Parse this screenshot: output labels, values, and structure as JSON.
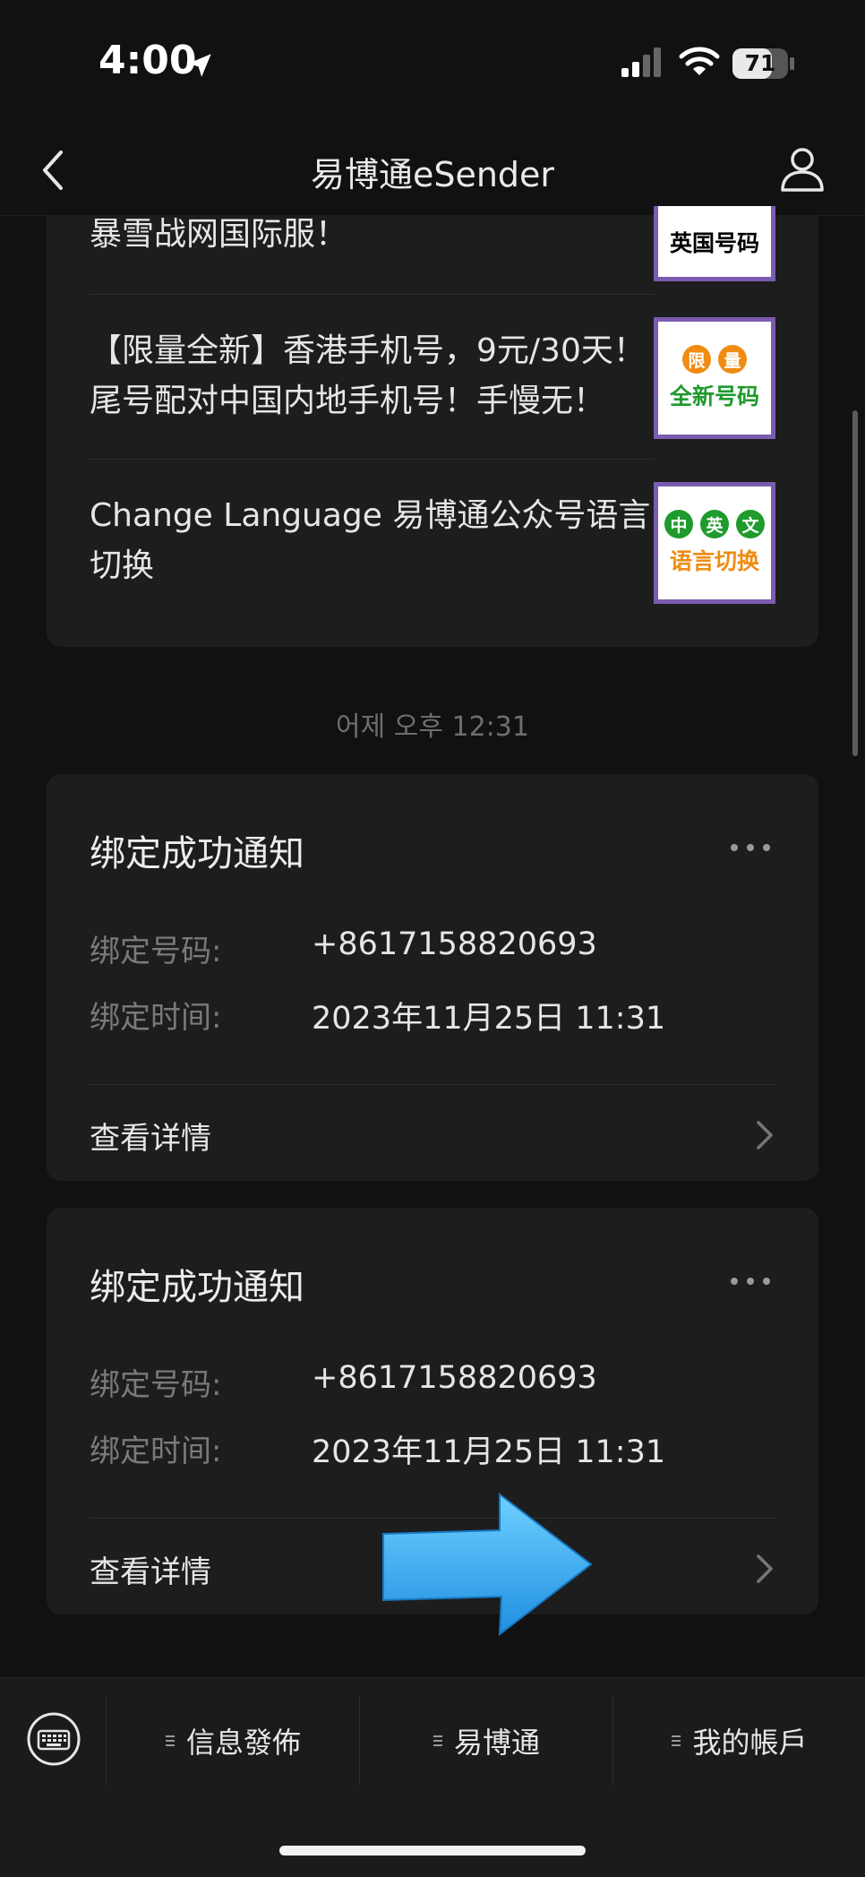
{
  "status_bar": {
    "time": "4:00",
    "battery": "71",
    "battery_level": 0.71
  },
  "nav": {
    "title": "易博通eSender"
  },
  "articles": [
    {
      "text": "暴雪战网国际服！",
      "thumb_text": "英国号码",
      "thumb_color": "#000000"
    },
    {
      "text": "【限量全新】香港手机号，9元/30天！尾号配对中国内地手机号！手慢无！",
      "thumb_circles": [
        "限",
        "量"
      ],
      "circle_color": "#f08c12",
      "thumb_text": "全新号码",
      "thumb_color": "#1f9a2c"
    },
    {
      "text": "Change Language 易博通公众号语言切换",
      "thumb_circles": [
        "中",
        "英",
        "文"
      ],
      "circle_color": "#1f9a2c",
      "thumb_text": "语言切换",
      "thumb_color": "#f08c12"
    }
  ],
  "timestamp": "어제 오후 12:31",
  "notifications": [
    {
      "title": "绑定成功通知",
      "number_label": "绑定号码:",
      "number_value": "+8617158820693",
      "time_label": "绑定时间:",
      "time_value": "2023年11月25日 11:31",
      "detail_label": "查看详情"
    },
    {
      "title": "绑定成功通知",
      "number_label": "绑定号码:",
      "number_value": "+8617158820693",
      "time_label": "绑定时间:",
      "time_value": "2023年11月25日 11:31",
      "detail_label": "查看详情"
    }
  ],
  "bottom_menu": {
    "items": [
      {
        "label": "信息發佈"
      },
      {
        "label": "易博通"
      },
      {
        "label": "我的帳戶"
      }
    ]
  },
  "colors": {
    "background": "#111111",
    "card": "#1d1d1d",
    "arrow": "#2fa9f0"
  }
}
